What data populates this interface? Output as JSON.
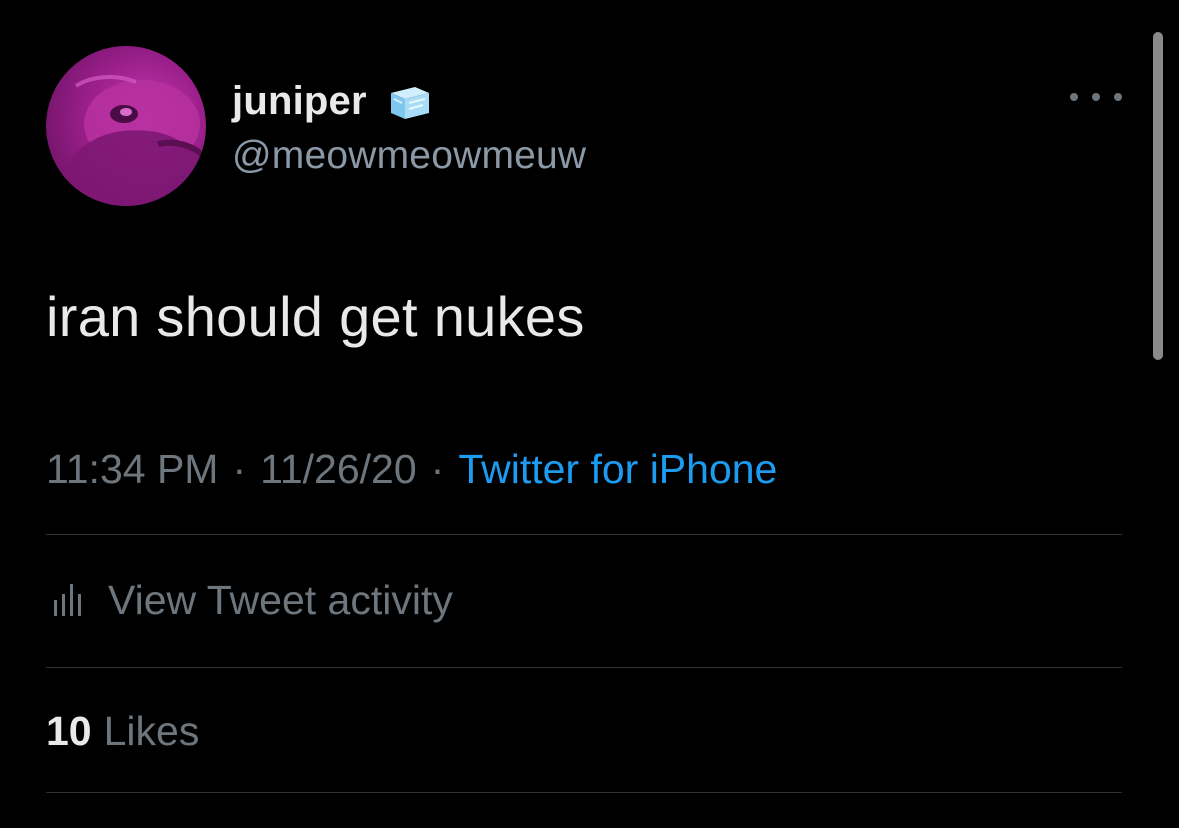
{
  "author": {
    "display_name": "juniper",
    "handle": "@meowmeowmeuw",
    "badge_icon": "ice-cube-emoji",
    "avatar_icon": "purple-creature-avatar"
  },
  "tweet": {
    "text": "iran should get nukes",
    "time": "11:34 PM",
    "date": "11/26/20",
    "separator": "·",
    "source": "Twitter for iPhone"
  },
  "activity": {
    "label": "View Tweet activity",
    "icon": "bar-chart-icon"
  },
  "likes": {
    "count": "10",
    "label": "Likes"
  },
  "menu": {
    "icon": "more-options-icon"
  },
  "colors": {
    "background": "#000000",
    "primary_text": "#e7e9ea",
    "secondary_text": "#6e767d",
    "link": "#1d9bf0",
    "divider": "#2f3336",
    "avatar": "#b02d9f"
  }
}
